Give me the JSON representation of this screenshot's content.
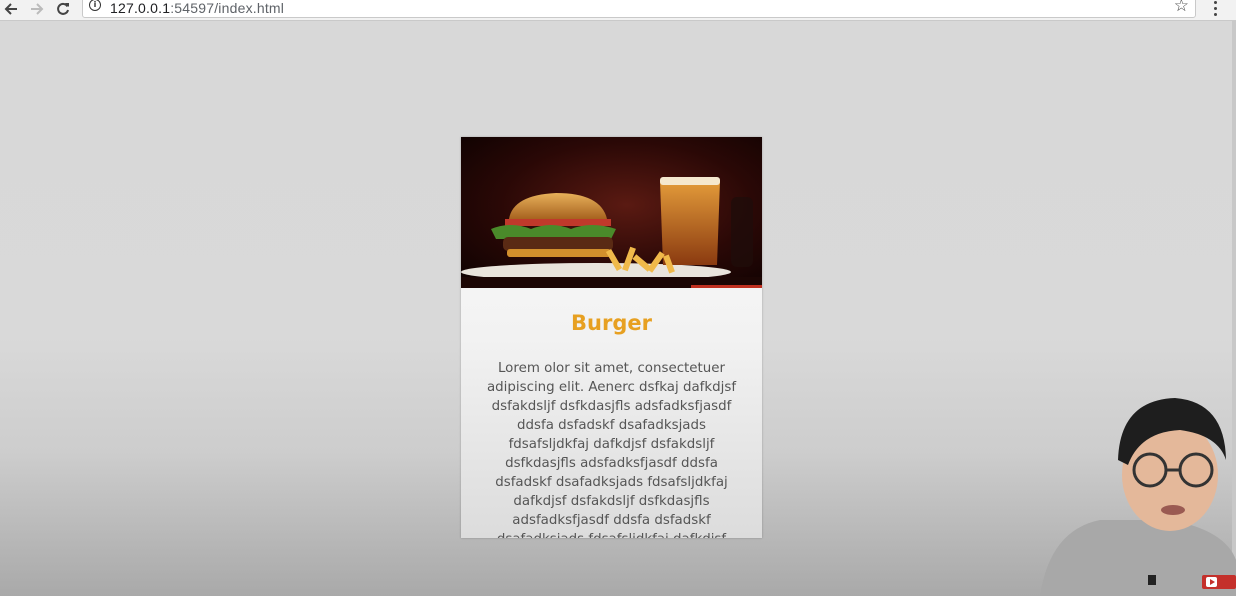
{
  "browser": {
    "url_host": "127.0.0.1",
    "url_rest": ":54597/index.html"
  },
  "card": {
    "title": "Burger",
    "image": "burger-with-fries-and-beer-photo",
    "text": "Lorem olor sit amet, consectetuer adipiscing elit. Aenerc dsfkaj dafkdjsf dsfakdsljf dsfkdasjfls adsfadksfjasdf ddsfa dsfadskf dsafadksjads fdsafsljdkfaj dafkdjsf dsfakdsljf dsfkdasjfls adsfadksfjasdf ddsfa dsfadskf dsafadksjads fdsafsljdkfaj dafkdjsf dsfakdsljf dsfkdasjfls adsfadksfjasdf ddsfa dsfadskf dsafadksjads fdsafsljdkfaj dafkdjsf",
    "title_color": "#e7a021"
  },
  "icons": {
    "back": "back-arrow-icon",
    "forward": "forward-arrow-icon",
    "reload": "reload-icon",
    "info": "info-icon",
    "star": "star-icon",
    "menu": "kebab-menu-icon"
  }
}
